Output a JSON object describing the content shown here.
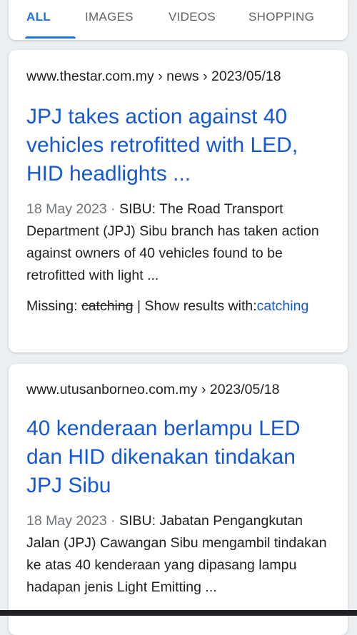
{
  "tabs": [
    {
      "label": "ALL",
      "active": true
    },
    {
      "label": "IMAGES",
      "active": false
    },
    {
      "label": "VIDEOS",
      "active": false
    },
    {
      "label": "SHOPPING",
      "active": false
    }
  ],
  "results": [
    {
      "url": "www.thestar.com.my › news › 2023/05/18",
      "title": "JPJ takes action against 40 vehicles retrofitted with LED, HID headlights ...",
      "date": "18 May 2023",
      "snippet": "SIBU: The Road Transport Department (JPJ) Sibu branch has taken action against owners of 40 vehicles found to be retrofitted with light ...",
      "missing_label": "Missing:",
      "missing_term": "catching",
      "show_results": "| Show results with:",
      "show_results_link": "catching"
    },
    {
      "url": "www.utusanborneo.com.my › 2023/05/18",
      "title": "40 kenderaan berlampu LED dan HID dikenakan tindakan JPJ Sibu",
      "date": "18 May 2023",
      "snippet": "SIBU: Jabatan Pengangkutan Jalan (JPJ) Cawangan Sibu mengambil tindakan ke atas 40 kenderaan yang dipasang lampu hadapan jenis Light Emitting ..."
    }
  ],
  "colors": {
    "accent": "#1a73e8",
    "link": "#1558d6",
    "text": "#202124",
    "muted": "#70757a"
  }
}
